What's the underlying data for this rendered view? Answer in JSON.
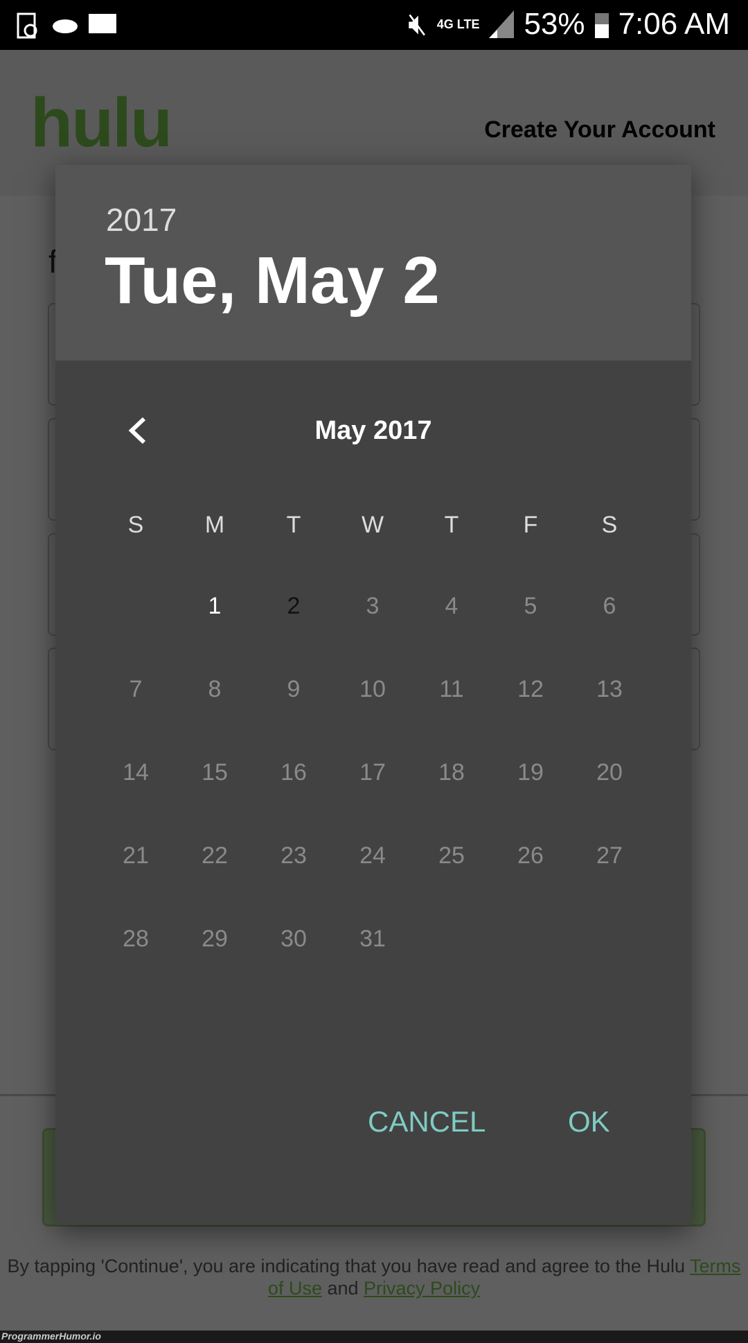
{
  "status": {
    "battery": "53%",
    "time": "7:06 AM",
    "network": "4G LTE",
    "left_icons": [
      "screen-rotate-icon",
      "cloud-icon",
      "message-icon"
    ],
    "right_icons": [
      "mute-vibrate-icon",
      "wifi-icon",
      "lte-icon",
      "signal-icon",
      "battery-icon"
    ]
  },
  "header": {
    "logo": "hulu",
    "title": "Create Your Account"
  },
  "background": {
    "partial_label": "f",
    "legal_prefix": "By tapping 'Continue', you are indicating that you have read and agree to the Hulu ",
    "terms": "Terms of Use",
    "and": " and ",
    "privacy": "Privacy Policy",
    "watermark": "ProgrammerHumor.io"
  },
  "dialog": {
    "year": "2017",
    "selected_date": "Tue, May 2",
    "month_label": "May 2017",
    "weekdays": [
      "S",
      "M",
      "T",
      "W",
      "T",
      "F",
      "S"
    ],
    "first_weekday_index": 1,
    "days_in_month": 31,
    "selected_day": 2,
    "today": 1,
    "cancel": "CANCEL",
    "ok": "OK",
    "accent": "#80cbc4"
  }
}
